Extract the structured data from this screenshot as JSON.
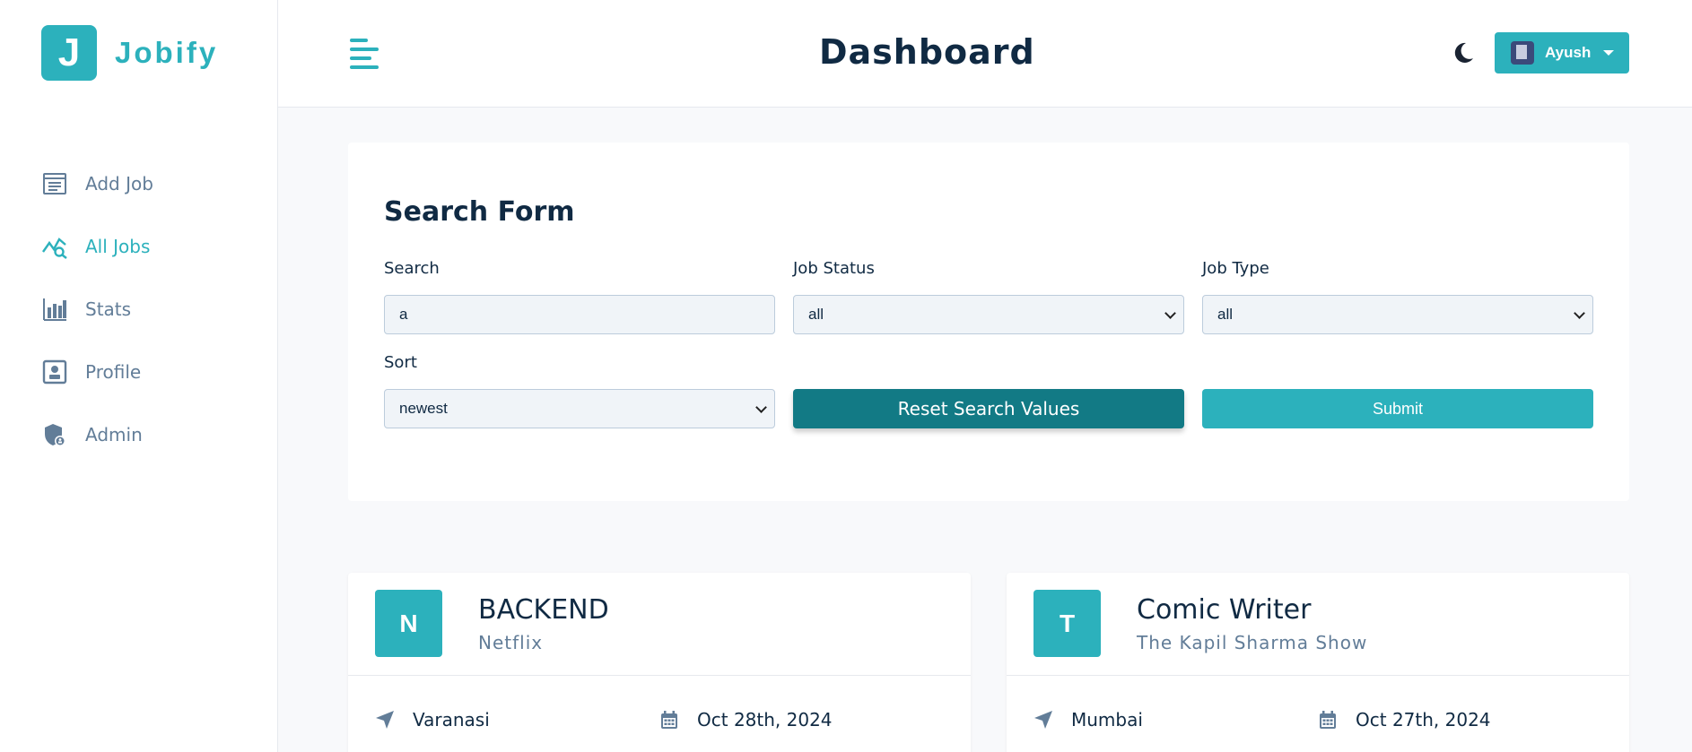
{
  "app": {
    "logo_letter": "J",
    "name": "Jobify"
  },
  "sidebar": {
    "items": [
      {
        "label": "Add Job",
        "icon": "add-job-icon"
      },
      {
        "label": "All Jobs",
        "icon": "all-jobs-icon",
        "active": true
      },
      {
        "label": "Stats",
        "icon": "stats-icon"
      },
      {
        "label": "Profile",
        "icon": "profile-icon"
      },
      {
        "label": "Admin",
        "icon": "admin-icon"
      }
    ]
  },
  "header": {
    "title": "Dashboard",
    "user_name": "Ayush"
  },
  "search_form": {
    "title": "Search Form",
    "search_label": "Search",
    "search_value": "a",
    "status_label": "Job Status",
    "status_value": "all",
    "type_label": "Job Type",
    "type_value": "all",
    "sort_label": "Sort",
    "sort_value": "newest",
    "reset_label": "Reset Search Values",
    "submit_label": "Submit"
  },
  "jobs": [
    {
      "letter": "N",
      "position": "BACKEND",
      "company": "Netflix",
      "location": "Varanasi",
      "date": "Oct 28th, 2024"
    },
    {
      "letter": "T",
      "position": "Comic Writer",
      "company": "The Kapil Sharma Show",
      "location": "Mumbai",
      "date": "Oct 27th, 2024"
    }
  ],
  "colors": {
    "accent": "#2cb1bc",
    "accent_dark": "#127a85",
    "text": "#102a43",
    "muted": "#627d98"
  }
}
